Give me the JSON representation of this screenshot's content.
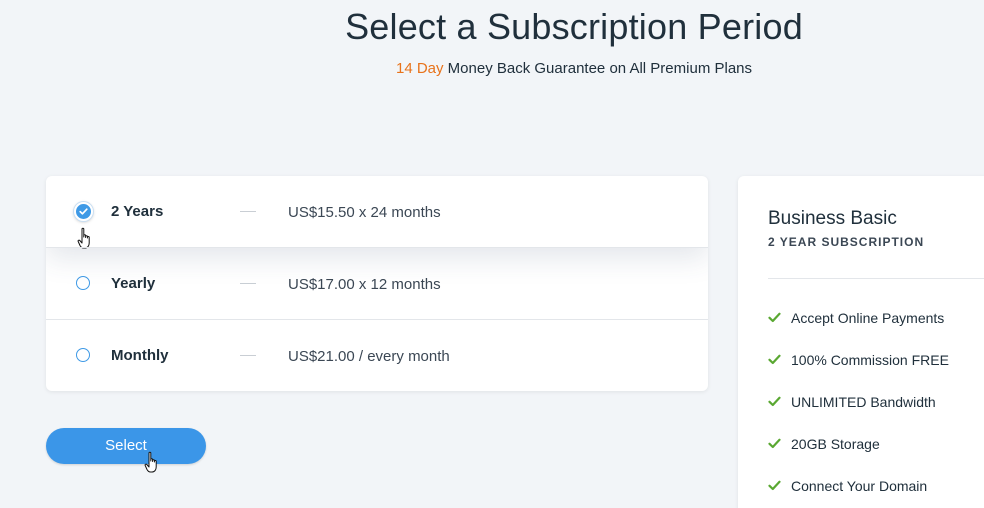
{
  "header": {
    "title": "Select a Subscription Period",
    "subtitle_accent": "14 Day",
    "subtitle_rest": " Money Back Guarantee on All Premium Plans",
    "accent_color": "#e8731b"
  },
  "periods": [
    {
      "label": "2 Years",
      "price": "US$15.50 x 24 months",
      "selected": true
    },
    {
      "label": "Yearly",
      "price": "US$17.00 x 12 months",
      "selected": false
    },
    {
      "label": "Monthly",
      "price": "US$21.00 / every month",
      "selected": false
    }
  ],
  "select_button": {
    "label": "Select",
    "color": "#3b96e8"
  },
  "summary": {
    "plan_name": "Business Basic",
    "plan_subtitle": "2 YEAR SUBSCRIPTION",
    "features": [
      "Accept Online Payments",
      "100% Commission FREE",
      "UNLIMITED Bandwidth",
      "20GB Storage",
      "Connect Your Domain"
    ],
    "check_color": "#5aa832"
  },
  "icons": {
    "checkmark": "check-icon",
    "cursor": "hand-pointer-icon"
  }
}
